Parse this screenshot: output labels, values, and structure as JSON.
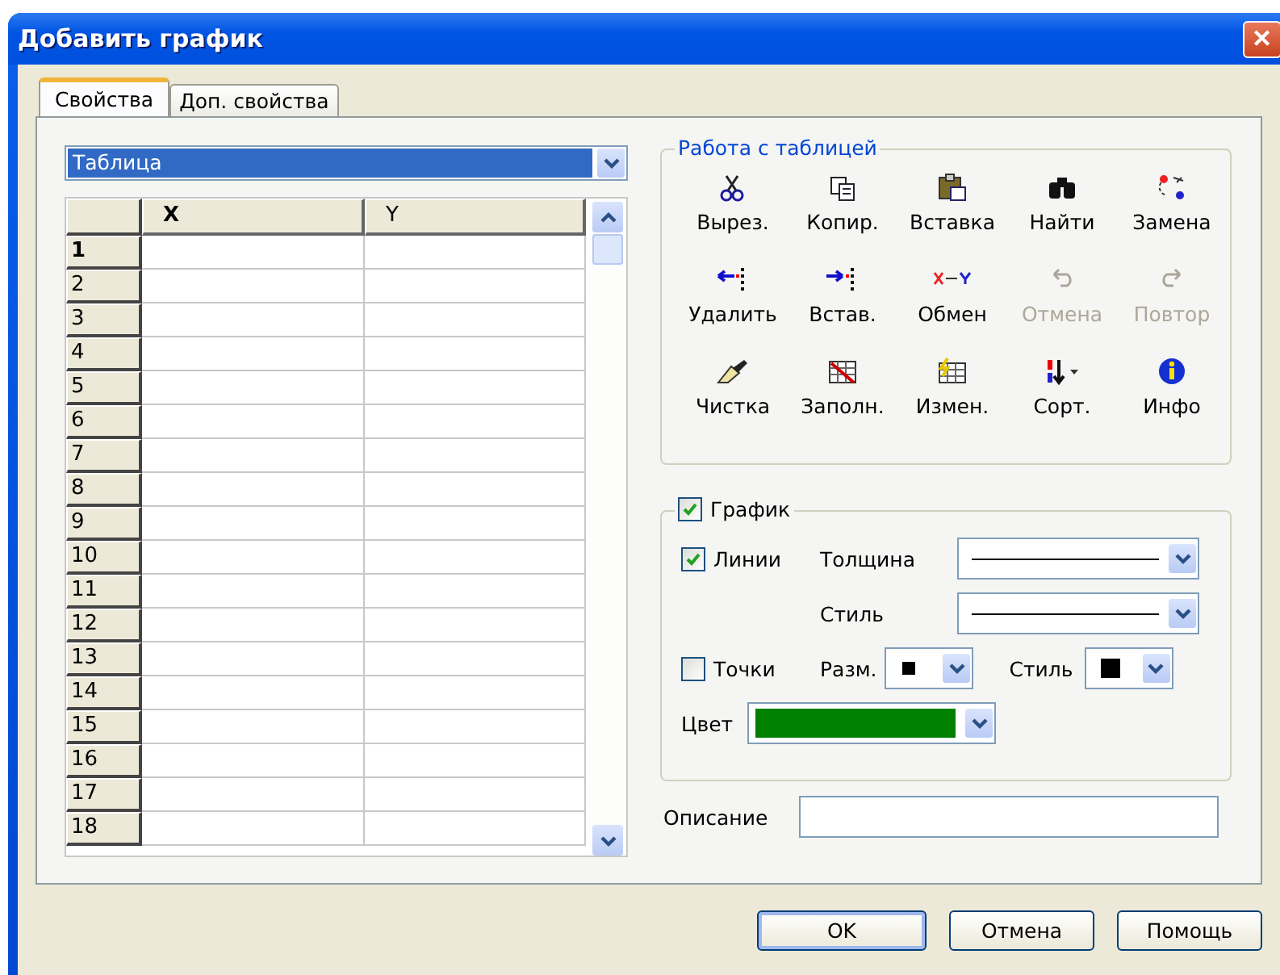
{
  "window": {
    "title": "Добавить график",
    "close": "✕"
  },
  "tabs": [
    {
      "label": "Свойства",
      "selected": true
    },
    {
      "label": "Доп. свойства",
      "selected": false
    }
  ],
  "source": {
    "value": "Таблица"
  },
  "table": {
    "columns": [
      "",
      "X",
      "Y"
    ],
    "rows": [
      {
        "label": "1",
        "selected": true
      },
      {
        "label": "2",
        "selected": false
      },
      {
        "label": "3",
        "selected": false
      },
      {
        "label": "4",
        "selected": false
      },
      {
        "label": "5",
        "selected": false
      },
      {
        "label": "6",
        "selected": false
      },
      {
        "label": "7",
        "selected": false
      },
      {
        "label": "8",
        "selected": false
      },
      {
        "label": "9",
        "selected": false
      },
      {
        "label": "10",
        "selected": false
      },
      {
        "label": "11",
        "selected": false
      },
      {
        "label": "12",
        "selected": false
      },
      {
        "label": "13",
        "selected": false
      },
      {
        "label": "14",
        "selected": false
      },
      {
        "label": "15",
        "selected": false
      },
      {
        "label": "16",
        "selected": false
      },
      {
        "label": "17",
        "selected": false
      },
      {
        "label": "18",
        "selected": false
      }
    ]
  },
  "table_tools": {
    "title": "Работа с таблицей",
    "items": [
      {
        "label": "Вырез.",
        "disabled": false
      },
      {
        "label": "Копир.",
        "disabled": false
      },
      {
        "label": "Вставка",
        "disabled": false
      },
      {
        "label": "Найти",
        "disabled": false
      },
      {
        "label": "Замена",
        "disabled": false
      },
      {
        "label": "Удалить",
        "disabled": false
      },
      {
        "label": "Встав.",
        "disabled": false
      },
      {
        "label": "Обмен",
        "disabled": false
      },
      {
        "label": "Отмена",
        "disabled": true
      },
      {
        "label": "Повтор",
        "disabled": true
      },
      {
        "label": "Чистка",
        "disabled": false
      },
      {
        "label": "Заполн.",
        "disabled": false
      },
      {
        "label": "Измен.",
        "disabled": false
      },
      {
        "label": "Сорт.",
        "disabled": false
      },
      {
        "label": "Инфо",
        "disabled": false
      }
    ]
  },
  "graph": {
    "label": "График",
    "checked": true,
    "lines": {
      "label": "Линии",
      "checked": true,
      "thickness_label": "Толщина",
      "style_label": "Стиль"
    },
    "points": {
      "label": "Точки",
      "checked": false,
      "size_label": "Разм.",
      "style_label": "Стиль"
    },
    "color_label": "Цвет",
    "color": "#008000"
  },
  "description": {
    "label": "Описание"
  },
  "buttons": [
    {
      "label": "OK",
      "default": true
    },
    {
      "label": "Отмена",
      "default": false
    },
    {
      "label": "Помощь",
      "default": false
    }
  ]
}
